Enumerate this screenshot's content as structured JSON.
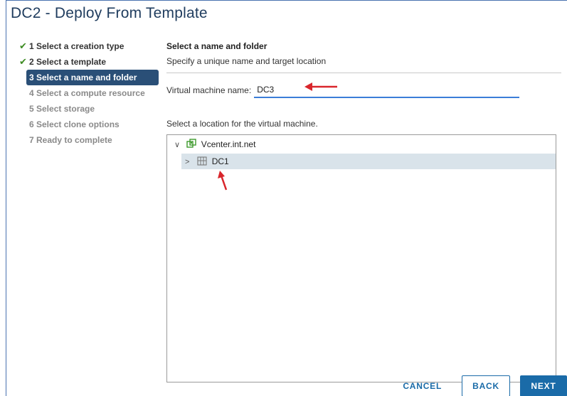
{
  "dialog": {
    "title": "DC2 - Deploy From Template"
  },
  "steps": [
    {
      "label": "1 Select a creation type",
      "state": "done"
    },
    {
      "label": "2 Select a template",
      "state": "done"
    },
    {
      "label": "3 Select a name and folder",
      "state": "active"
    },
    {
      "label": "4 Select a compute resource",
      "state": "todo"
    },
    {
      "label": "5 Select storage",
      "state": "todo"
    },
    {
      "label": "6 Select clone options",
      "state": "todo"
    },
    {
      "label": "7 Ready to complete",
      "state": "todo"
    }
  ],
  "main": {
    "heading": "Select a name and folder",
    "subheading": "Specify a unique name and target location",
    "vm_name_label": "Virtual machine name:",
    "vm_name_value": "DC3",
    "location_label": "Select a location for the virtual machine."
  },
  "tree": {
    "root": {
      "label": "Vcenter.int.net",
      "expanded": true,
      "icon": "vcenter-icon"
    },
    "children": [
      {
        "label": "DC1",
        "expanded": false,
        "selected": true,
        "icon": "datacenter-icon"
      }
    ]
  },
  "footer": {
    "cancel": "CANCEL",
    "back": "BACK",
    "next": "NEXT"
  },
  "colors": {
    "accent": "#1a6ba8",
    "active_step": "#2a4f77",
    "check": "#3d8b22",
    "annotation_arrow": "#d9262c"
  }
}
